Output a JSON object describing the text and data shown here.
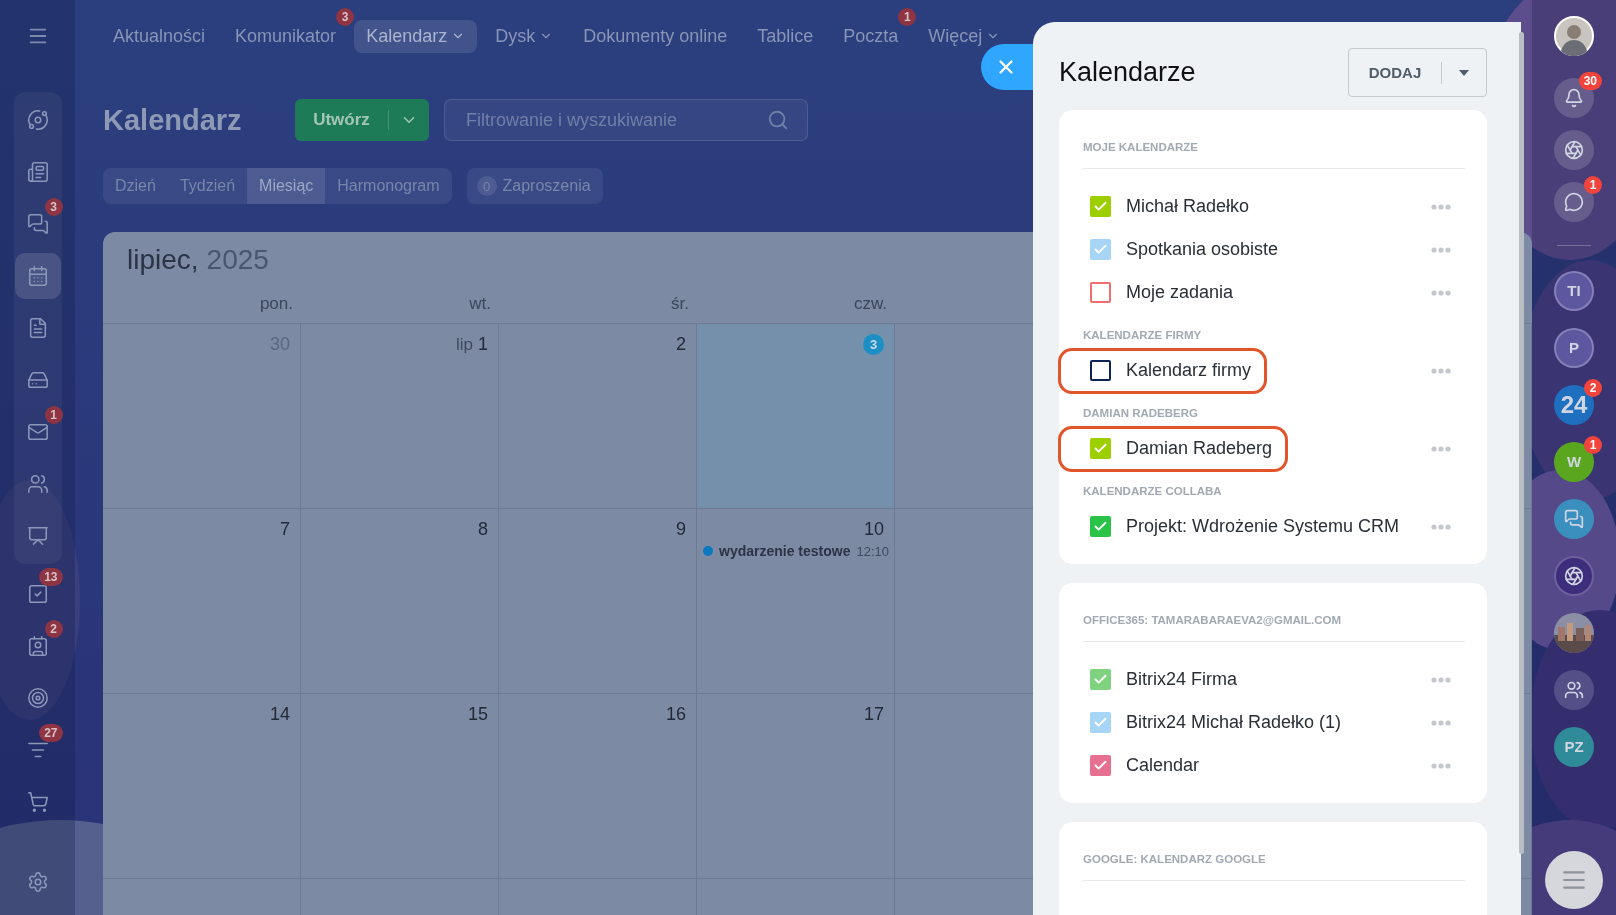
{
  "top_nav": {
    "items": [
      {
        "label": "Aktualności",
        "selected": false,
        "dropdown": false
      },
      {
        "label": "Komunikator",
        "selected": false,
        "dropdown": false,
        "badge": "3"
      },
      {
        "label": "Kalendarz",
        "selected": true,
        "dropdown": true
      },
      {
        "label": "Dysk",
        "selected": false,
        "dropdown": true
      },
      {
        "label": "Dokumenty online",
        "selected": false,
        "dropdown": false
      },
      {
        "label": "Tablice",
        "selected": false,
        "dropdown": false
      },
      {
        "label": "Poczta",
        "selected": false,
        "dropdown": false,
        "badge": "1"
      },
      {
        "label": "Więcej",
        "selected": false,
        "dropdown": true
      }
    ]
  },
  "left_sidebar": {
    "pinned": [
      {
        "kind": "orbit",
        "selected": false
      },
      {
        "kind": "news",
        "selected": false
      },
      {
        "kind": "chat",
        "selected": false,
        "badge": "3"
      },
      {
        "kind": "calendar",
        "selected": true
      },
      {
        "kind": "document",
        "selected": false
      },
      {
        "kind": "drive",
        "selected": false
      },
      {
        "kind": "mail",
        "selected": false,
        "badge": "1"
      },
      {
        "kind": "users",
        "selected": false
      },
      {
        "kind": "board",
        "selected": false
      }
    ],
    "more": [
      {
        "kind": "tasks",
        "selected": false,
        "badge": "13"
      },
      {
        "kind": "contacts",
        "selected": false,
        "badge": "2"
      },
      {
        "kind": "target",
        "selected": false
      },
      {
        "kind": "filter",
        "selected": false,
        "badge": "27"
      },
      {
        "kind": "cart",
        "selected": false
      }
    ]
  },
  "calendar": {
    "title": "Kalendarz",
    "create_button": "Utwórz",
    "search": {
      "placeholder": "Filtrowanie i wyszukiwanie"
    },
    "views": [
      {
        "label": "Dzień",
        "selected": false
      },
      {
        "label": "Tydzień",
        "selected": false
      },
      {
        "label": "Miesiąc",
        "selected": true
      },
      {
        "label": "Harmonogram",
        "selected": false
      }
    ],
    "invitations": {
      "count": "0",
      "label": "Zaproszenia"
    },
    "month": "lipiec,",
    "year": "2025",
    "weekdays": [
      "pon.",
      "wt.",
      "śr.",
      "czw."
    ],
    "weeks": [
      [
        {
          "day": "30",
          "other_month": true,
          "today": false
        },
        {
          "prefix": "lip",
          "day": "1",
          "other_month": false,
          "today": false
        },
        {
          "day": "2",
          "other_month": false,
          "today": false
        },
        {
          "day": "3",
          "other_month": false,
          "today": true
        }
      ],
      [
        {
          "day": "7",
          "other_month": false,
          "today": false
        },
        {
          "day": "8",
          "other_month": false,
          "today": false
        },
        {
          "day": "9",
          "other_month": false,
          "today": false
        },
        {
          "day": "10",
          "other_month": false,
          "today": false,
          "events": [
            {
              "title": "wydarzenie testowe",
              "time": "12:10",
              "color": "#0b78c2"
            }
          ]
        }
      ],
      [
        {
          "day": "14",
          "other_month": false,
          "today": false
        },
        {
          "day": "15",
          "other_month": false,
          "today": false
        },
        {
          "day": "16",
          "other_month": false,
          "today": false
        },
        {
          "day": "17",
          "other_month": false,
          "today": false
        }
      ]
    ]
  },
  "panel": {
    "title": "Kalendarze",
    "add_button": "DODAJ",
    "cards": [
      {
        "sections": [
          {
            "heading": "MOJE KALENDARZE",
            "items": [
              {
                "label": "Michał Radełko",
                "color": "#9dcf00",
                "checked": true,
                "highlighted": false
              },
              {
                "label": "Spotkania osobiste",
                "color": "#a6d5f5",
                "checked": true,
                "highlighted": false
              },
              {
                "label": "Moje zadania",
                "color": "#f16e6e",
                "checked": false,
                "highlighted": false
              }
            ]
          },
          {
            "heading": "KALENDARZE FIRMY",
            "items": [
              {
                "label": "Kalendarz firmy",
                "color": "#0b2655",
                "checked": false,
                "highlighted": true
              }
            ]
          },
          {
            "heading": "DAMIAN RADEBERG",
            "items": [
              {
                "label": "Damian Radeberg",
                "color": "#9dcf00",
                "checked": true,
                "highlighted": true
              }
            ]
          },
          {
            "heading": "KALENDARZE COLLABA",
            "items": [
              {
                "label": "Projekt: Wdrożenie Systemu CRM",
                "color": "#29c447",
                "checked": true,
                "highlighted": false
              }
            ]
          }
        ]
      },
      {
        "sections": [
          {
            "heading": "OFFICE365: TAMARABARAEVA2@GMAIL.COM",
            "items": [
              {
                "label": "Bitrix24 Firma",
                "color": "#7fd27f",
                "checked": true,
                "highlighted": false
              },
              {
                "label": "Bitrix24 Michał Radełko (1)",
                "color": "#a6d5f5",
                "checked": true,
                "highlighted": false
              },
              {
                "label": "Calendar",
                "color": "#e76f90",
                "checked": true,
                "highlighted": false
              }
            ]
          }
        ]
      },
      {
        "sections": [
          {
            "heading": "GOOGLE: KALENDARZ GOOGLE"
          }
        ]
      }
    ]
  },
  "right_sidebar": {
    "items": [
      {
        "kind": "avatar"
      },
      {
        "kind": "bell",
        "badge": "30"
      },
      {
        "kind": "copilot"
      },
      {
        "kind": "chat",
        "badge": "1"
      },
      {
        "kind": "divider"
      },
      {
        "kind": "initials",
        "text": "TI",
        "color": "#5d57a0"
      },
      {
        "kind": "initials",
        "text": "P",
        "color": "#5d57a0"
      },
      {
        "kind": "logo",
        "text": "24",
        "badge": "2",
        "color": "#1f6fc0"
      },
      {
        "kind": "initials",
        "text": "W",
        "badge": "1",
        "color": "#5aa61e"
      },
      {
        "kind": "messages"
      },
      {
        "kind": "copilot_dark"
      },
      {
        "kind": "picture"
      },
      {
        "kind": "group"
      },
      {
        "kind": "initials",
        "text": "PZ",
        "color": "#2f8b97"
      }
    ]
  }
}
